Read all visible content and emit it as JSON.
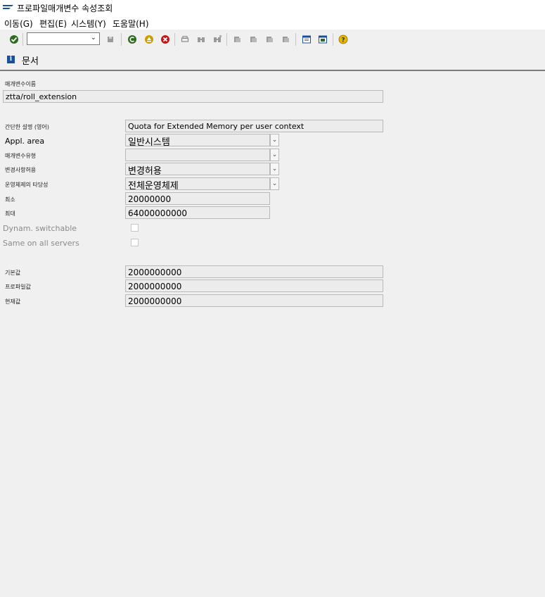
{
  "window": {
    "title": "프로파일매개변수 속성조회"
  },
  "menu": [
    {
      "label": "이동(G)"
    },
    {
      "label": "편집(E)"
    },
    {
      "label": "시스템(Y)"
    },
    {
      "label": "도움말(H)"
    }
  ],
  "toolbar": {
    "icons": [
      "enter-icon",
      "command-field",
      "save-icon",
      "back-icon",
      "exit-icon",
      "cancel-icon",
      "print-icon",
      "find-icon",
      "find-next-icon",
      "first-page-icon",
      "previous-page-icon",
      "next-page-icon",
      "last-page-icon",
      "new-session-icon",
      "shortcut-icon",
      "help-icon"
    ]
  },
  "app_toolbar": {
    "documentation_label": "문서"
  },
  "form": {
    "param_name_label": "매개변수이름",
    "param_name_value": "ztta/roll_extension",
    "short_desc_label": "간단한 설명 (영어)",
    "short_desc_value": "Quota for Extended Memory per user context",
    "appl_area_label": "Appl. area",
    "appl_area_value": "일반시스템",
    "param_type_label": "매개변수유형",
    "param_type_value": "",
    "change_perm_label": "변경사항허용",
    "change_perm_value": "변경허용",
    "os_validity_label": "운영체제의 타당성",
    "os_validity_value": "전체운영체제",
    "min_label": "최소",
    "min_value": "20000000",
    "max_label": "최대",
    "max_value": "64000000000",
    "dynamic_label": "Dynam. switchable",
    "dynamic_checked": false,
    "same_servers_label": "Same on all servers",
    "same_servers_checked": false,
    "default_label": "기본값",
    "default_value": "2000000000",
    "profile_label": "프로파일값",
    "profile_value": "2000000000",
    "current_label": "현재값",
    "current_value": "2000000000"
  },
  "colors": {
    "accent": "#1b4f9c",
    "field_bg": "#ececec",
    "background": "#f0f0f0"
  }
}
